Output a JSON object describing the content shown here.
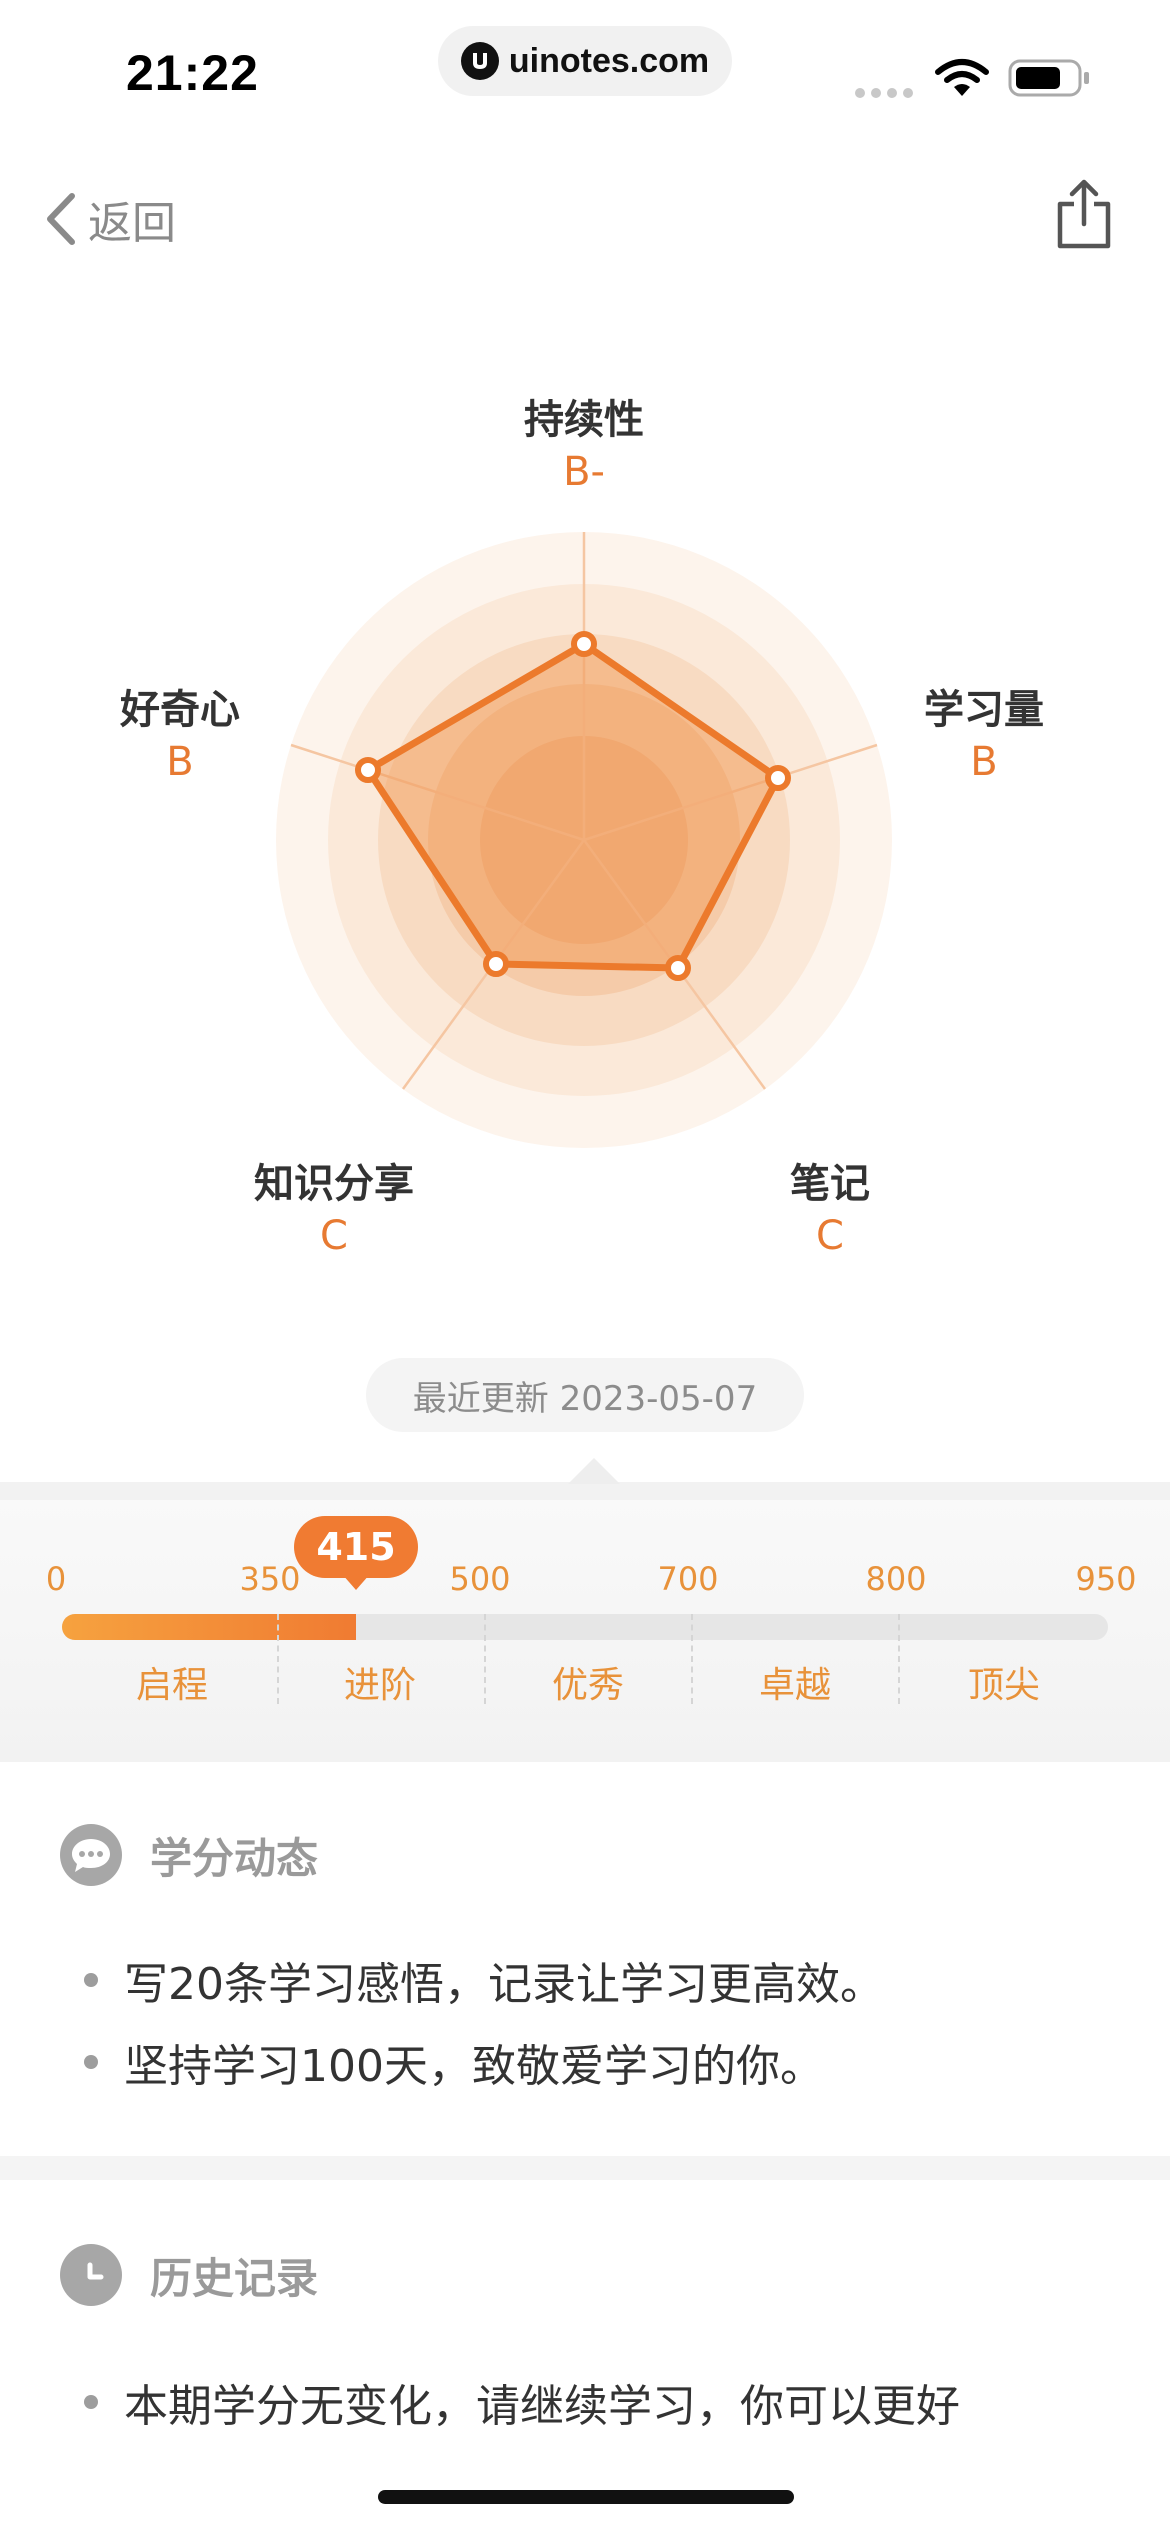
{
  "status_bar": {
    "time": "21:22",
    "url": "uinotes.com"
  },
  "nav": {
    "back_label": "返回"
  },
  "radar": {
    "axes": [
      {
        "label": "持续性",
        "grade": "B-"
      },
      {
        "label": "学习量",
        "grade": "B"
      },
      {
        "label": "笔记",
        "grade": "C"
      },
      {
        "label": "知识分享",
        "grade": "C"
      },
      {
        "label": "好奇心",
        "grade": "B"
      }
    ],
    "accent": "#e77a32"
  },
  "update": {
    "text": "最近更新 2023-05-07"
  },
  "score": {
    "value": "415",
    "ticks": [
      "0",
      "350",
      "500",
      "700",
      "800",
      "950"
    ],
    "levels": [
      "启程",
      "进阶",
      "优秀",
      "卓越",
      "顶尖"
    ],
    "accent": "#f07b32"
  },
  "credit_activity": {
    "title": "学分动态",
    "items": [
      "写20条学习感悟，记录让学习更高效。",
      "坚持学习100天，致敬爱学习的你。"
    ]
  },
  "history": {
    "title": "历史记录",
    "items": [
      "本期学分无变化，请继续学习，你可以更好"
    ]
  }
}
